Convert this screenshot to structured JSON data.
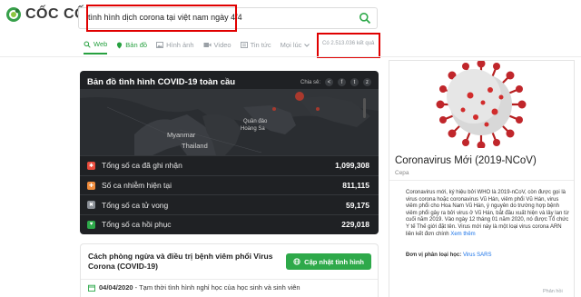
{
  "header": {
    "logo_text": "CỐC CỐC",
    "search_value": "tình hình dịch corona tại việt nam ngày 4/4",
    "result_count": "Có 2.513.036 kết quả"
  },
  "tabs": [
    {
      "label": "Web",
      "icon": "search-icon"
    },
    {
      "label": "Bản đồ",
      "icon": "map-pin-icon"
    },
    {
      "label": "Hình ảnh",
      "icon": "image-icon"
    },
    {
      "label": "Video",
      "icon": "video-icon"
    },
    {
      "label": "Tin tức",
      "icon": "news-icon"
    },
    {
      "label": "Mọi lúc",
      "icon": "chevron-down-icon"
    }
  ],
  "covid": {
    "title": "Bản đồ tình hình COVID-19 toàn cầu",
    "share_label": "Chia sẻ:",
    "map_labels": {
      "myanmar": "Myanmar",
      "thailand": "Thailand",
      "quan_dao": "Quần đảo",
      "hoang_sa": "Hoàng Sa"
    },
    "stats": [
      {
        "label": "Tổng số ca đã ghi nhận",
        "value": "1,099,308",
        "color": "#e94b3c"
      },
      {
        "label": "Số ca nhiễm hiện tại",
        "value": "811,115",
        "color": "#f08c3c"
      },
      {
        "label": "Tổng số ca tử vong",
        "value": "59,175",
        "color": "#8a8f96"
      },
      {
        "label": "Tổng số ca hồi phục",
        "value": "229,018",
        "color": "#2ea94a"
      }
    ]
  },
  "prevention": {
    "title": "Cách phòng ngừa và điều trị bệnh viêm phổi Virus Corona (COVID-19)",
    "update_button": "Cập nhật tình hình",
    "date": "04/04/2020",
    "date_text": " - Tạm thời tình hình nghỉ học của học sinh và sinh viên"
  },
  "knowledge_panel": {
    "title": "Coronavirus Mới (2019-NCoV)",
    "subtitle": "Cepa",
    "description": "Coronavirus mới, ký hiệu bởi WHO là 2019-nCoV, còn được gọi là virus corona hoặc coronavirus Vũ Hán, viêm phổi Vũ Hán, virus viêm phổi cho Hoa Nam Vũ Hán, ý nguyên do trường hợp bệnh viêm phổi gây ra bởi virus ở Vũ Hán, bắt đầu xuất hiện và lây lan từ cuối năm 2019. Vào ngày 12 tháng 01 năm 2020, nó được Tổ chức Y tế Thế giới đặt tên. Virus mới này là một loại virus corona ARN liên kết đơn chính",
    "see_more": "Xem thêm",
    "classification_label": "Đơn vị phân loại học:",
    "classification_value": "Virus SARS"
  },
  "footer": {
    "feedback": "Phản hồi"
  },
  "colors": {
    "accent_green": "#2ea94a",
    "highlight_red": "#e00000",
    "card_dark": "#1f2124"
  }
}
